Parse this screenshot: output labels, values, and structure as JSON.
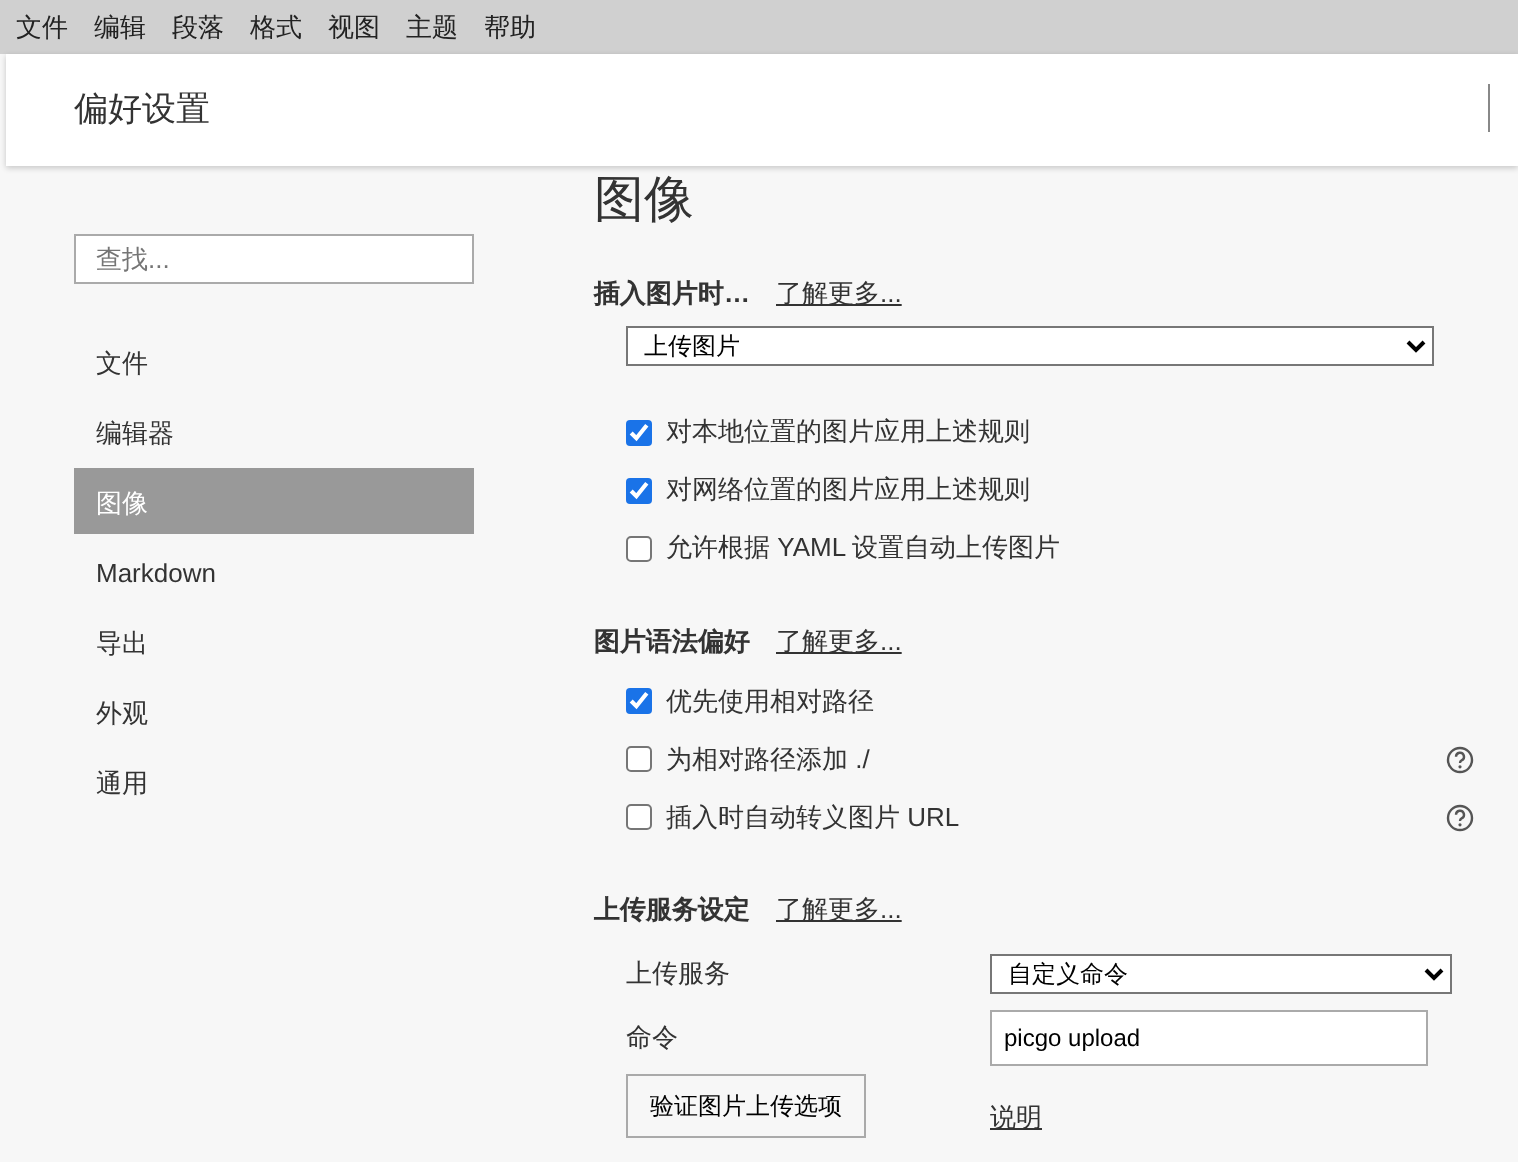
{
  "menu": [
    "文件",
    "编辑",
    "段落",
    "格式",
    "视图",
    "主题",
    "帮助"
  ],
  "header": {
    "title": "偏好设置"
  },
  "sidebar": {
    "search": {
      "placeholder": "查找..."
    },
    "items": [
      {
        "label": "文件",
        "selected": false
      },
      {
        "label": "编辑器",
        "selected": false
      },
      {
        "label": "图像",
        "selected": true
      },
      {
        "label": "Markdown",
        "selected": false
      },
      {
        "label": "导出",
        "selected": false
      },
      {
        "label": "外观",
        "selected": false
      },
      {
        "label": "通用",
        "selected": false
      }
    ]
  },
  "content": {
    "title": "图像",
    "sections": [
      {
        "title": "插入图片时…",
        "link": "了解更多...",
        "items": [
          {
            "kind": "select",
            "value": "上传图片"
          },
          {
            "kind": "checkbox",
            "label": "对本地位置的图片应用上述规则",
            "checked": true,
            "help": false
          },
          {
            "kind": "checkbox",
            "label": "对网络位置的图片应用上述规则",
            "checked": true,
            "help": false
          },
          {
            "kind": "checkbox",
            "label": "允许根据 YAML 设置自动上传图片",
            "checked": false,
            "help": false
          }
        ]
      },
      {
        "title": "图片语法偏好",
        "link": "了解更多...",
        "items": [
          {
            "kind": "checkbox",
            "label": "优先使用相对路径",
            "checked": true,
            "help": false
          },
          {
            "kind": "checkbox",
            "label": "为相对路径添加 ./",
            "checked": false,
            "help": true
          },
          {
            "kind": "checkbox",
            "label": "插入时自动转义图片 URL",
            "checked": false,
            "help": true
          }
        ]
      },
      {
        "title": "上传服务设定",
        "link": "了解更多...",
        "items": [
          {
            "kind": "select-row",
            "label": "上传服务",
            "value": "自定义命令"
          },
          {
            "kind": "input-row",
            "label": "命令",
            "value": "picgo upload"
          },
          {
            "kind": "button-row",
            "button": "验证图片上传选项",
            "link": "说明"
          }
        ]
      }
    ]
  }
}
